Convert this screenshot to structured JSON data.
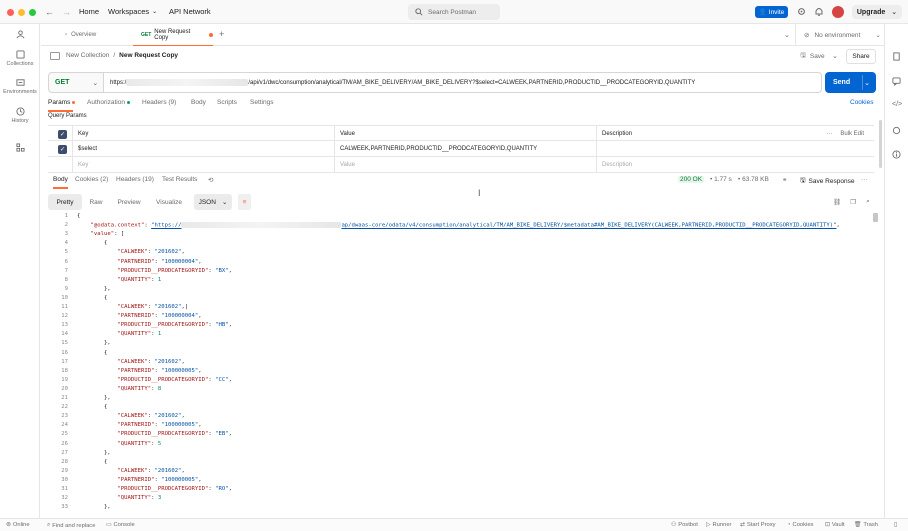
{
  "topbar": {
    "home": "Home",
    "workspaces": "Workspaces",
    "api_network": "API Network",
    "search_placeholder": "Search Postman",
    "invite": "Invite",
    "upgrade": "Upgrade"
  },
  "sidebar": {
    "items": [
      {
        "label": "",
        "icon": "user-icon"
      },
      {
        "label": "Collections",
        "icon": "collections-icon"
      },
      {
        "label": "Environments",
        "icon": "environments-icon"
      },
      {
        "label": "History",
        "icon": "history-icon"
      },
      {
        "label": "",
        "icon": "flows-icon"
      }
    ]
  },
  "tabs": {
    "overview": "Overview",
    "active_method": "GET",
    "active_label": "New Request Copy",
    "environment": "No environment"
  },
  "breadcrumb": {
    "collection": "New Collection",
    "separator": "/",
    "request": "New Request Copy",
    "save": "Save",
    "share": "Share"
  },
  "request": {
    "method": "GET",
    "url_prefix": "https:/",
    "url_suffix": "/api/v1/dwc/consumption/analytical/TM/AM_BIKE_DELIVERY/AM_BIKE_DELIVERY?$select=CALWEEK,PARTNERID,PRODUCTID__PRODCATEGORYID,QUANTITY",
    "send": "Send"
  },
  "request_tabs": {
    "params": "Params",
    "authorization": "Authorization",
    "headers": "Headers (9)",
    "body": "Body",
    "scripts": "Scripts",
    "settings": "Settings",
    "cookies": "Cookies",
    "query_params": "Query Params"
  },
  "params_table": {
    "headers": [
      "Key",
      "Value",
      "Description"
    ],
    "bulk_edit": "Bulk Edit",
    "rows": [
      {
        "key": "$select",
        "value": "CALWEEK,PARTNERID,PRODUCTID__PRODCATEGORYID,QUANTITY",
        "description": ""
      }
    ],
    "placeholder": {
      "key": "Key",
      "value": "Value",
      "description": "Description"
    }
  },
  "response": {
    "tabs": [
      "Body",
      "Cookies (2)",
      "Headers (19)",
      "Test Results"
    ],
    "status": "200 OK",
    "time": "1.77 s",
    "size": "63.78 KB",
    "save_response": "Save Response",
    "formats": [
      "Pretty",
      "Raw",
      "Preview",
      "Visualize"
    ],
    "language": "JSON"
  },
  "code": {
    "context_key": "\"@odata.context\"",
    "context_prefix": "\"https://",
    "context_suffix": "ap/dwaas-core/odata/v4/consumption/analytical/TM/AM_BIKE_DELIVERY/$metadata#AM_BIKE_DELIVERY(CALWEEK,PARTNERID,PRODUCTID__PRODCATEGORYID,QUANTITY)\"",
    "records": [
      {
        "calweek": "\"201602\"",
        "partner": "\"100000004\"",
        "category": "\"BX\"",
        "quantity": "1"
      },
      {
        "calweek": "\"201602\"",
        "partner": "\"100000004\"",
        "category": "\"HB\"",
        "quantity": "1"
      },
      {
        "calweek": "\"201602\"",
        "partner": "\"100000005\"",
        "category": "\"CC\"",
        "quantity": "8"
      },
      {
        "calweek": "\"201602\"",
        "partner": "\"100000005\"",
        "category": "\"EB\"",
        "quantity": "5"
      },
      {
        "calweek": "\"201602\"",
        "partner": "\"100000005\"",
        "category": "\"RO\"",
        "quantity": "3"
      }
    ]
  },
  "statusbar": {
    "online": "Online",
    "find_replace": "Find and replace",
    "console": "Console",
    "postbot": "Postbot",
    "runner": "Runner",
    "start_proxy": "Start Proxy",
    "cookies": "Cookies",
    "vault": "Vault",
    "trash": "Trash"
  },
  "colors": {
    "accent": "#ff6c37",
    "primary": "#0265d2",
    "get": "#007f31",
    "ok": "#007f31"
  }
}
